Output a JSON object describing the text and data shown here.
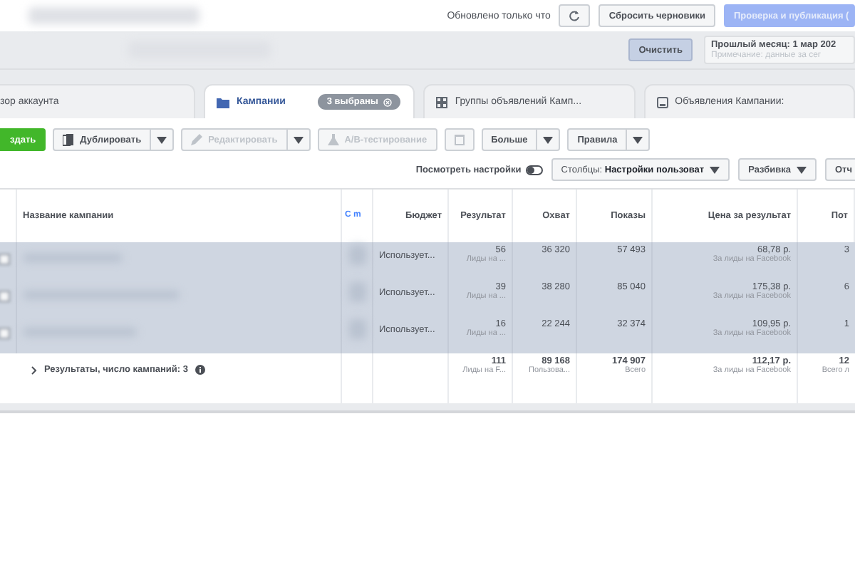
{
  "top_bar": {
    "status": "Обновлено только что",
    "reset_button": "Сбросить черновики",
    "publish_button": {
      "label": "Проверка и публикация (",
      "disabled": true
    },
    "clear_button": "Очистить",
    "date_range": {
      "label": "Прошлый месяц: 1 мар 202",
      "note": "Примечание: данные за сег"
    }
  },
  "tabs": [
    {
      "label": "зор аккаунта",
      "selected": false,
      "kind": "overview"
    },
    {
      "label": "Кампании",
      "selected": true,
      "kind": "campaigns",
      "badge": "3 выбраны"
    },
    {
      "label": "Группы объявлений Камп...",
      "selected": false,
      "kind": "adsets"
    },
    {
      "label": "Объявления Кампании:",
      "selected": false,
      "kind": "ads"
    }
  ],
  "toolbar": [
    {
      "label": "здать",
      "kind": "create",
      "disabled": false,
      "dropdown": false
    },
    {
      "label": "Дублировать",
      "kind": "duplicate",
      "disabled": false,
      "dropdown": true
    },
    {
      "label": "Редактировать",
      "kind": "edit",
      "disabled": true,
      "dropdown": true
    },
    {
      "label": "A/B-тестирование",
      "kind": "test",
      "disabled": true,
      "dropdown": false
    },
    {
      "kind": "delete",
      "disabled": true,
      "dropdown": false
    },
    {
      "label": "Больше",
      "kind": "plain",
      "disabled": false,
      "dropdown": true
    },
    {
      "label": "Правила",
      "kind": "plain",
      "disabled": false,
      "dropdown": true
    }
  ],
  "view_bar": {
    "settings_toggle": {
      "label": "Посмотреть настройки",
      "on": false
    },
    "columns_button": "Столбцы: **Настройки пользоват**",
    "breakdown_button": "Разбивка",
    "reports_button": "Отч"
  },
  "table": {
    "columns": [
      "Название кампании",
      "С m",
      "Бюджет",
      "Результат",
      "Охват",
      "Показы",
      "Цена за результат",
      "Пот"
    ],
    "rows": [
      {
        "selected": true,
        "budget": "Использует...",
        "result": "56",
        "result_note": "Лиды на ...",
        "reach": "36 320",
        "impressions": "57 493",
        "cost": "68,78 р.",
        "cost_note": "За лиды на Facebook",
        "column_9": "3"
      },
      {
        "selected": true,
        "budget": "Использует...",
        "result": "39",
        "result_note": "Лиды на ...",
        "reach": "38 280",
        "impressions": "85 040",
        "cost": "175,38 р.",
        "cost_note": "За лиды на Facebook",
        "column_9": "6"
      },
      {
        "selected": true,
        "budget": "Использует...",
        "result": "16",
        "result_note": "Лиды на ...",
        "reach": "22 244",
        "impressions": "32 374",
        "cost": "109,95 р.",
        "cost_note": "За лиды на Facebook",
        "column_9": "1"
      }
    ],
    "summary": {
      "label": "Результаты, число кампаний: 3",
      "result": "111",
      "result_note": "Лиды на F...",
      "reach": "89 168",
      "reach_note": "Пользова...",
      "impressions": "174 907",
      "impressions_note": "Всего",
      "cost": "112,17 р.",
      "cost_note": "За лиды на Facebook",
      "column_9": "12",
      "column_9_note": "Всего л"
    }
  }
}
